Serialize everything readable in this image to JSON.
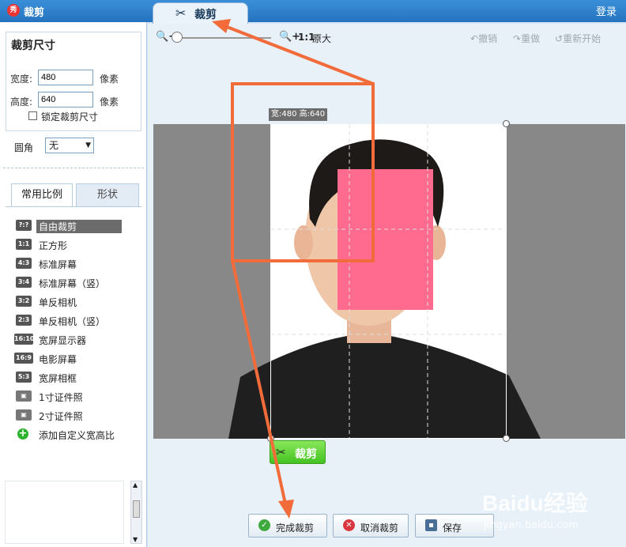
{
  "titlebar": {
    "app_icon_text": "秀",
    "title": "裁剪",
    "login": "登录"
  },
  "tab": {
    "label": "裁剪",
    "icon": "scissors-icon"
  },
  "size_panel": {
    "title": "裁剪尺寸",
    "width_label": "宽度:",
    "width_value": "480",
    "height_label": "高度:",
    "height_value": "640",
    "unit": "像素",
    "lock_label": "锁定裁剪尺寸",
    "lock_checked": false,
    "corner_label": "圆角",
    "corner_value": "无"
  },
  "ratio_tabs": {
    "common": "常用比例",
    "shape": "形状"
  },
  "ratios": [
    {
      "icon": "?:?",
      "label": "自由裁剪",
      "selected": true
    },
    {
      "icon": "1:1",
      "label": "正方形"
    },
    {
      "icon": "4:3",
      "label": "标准屏幕"
    },
    {
      "icon": "3:4",
      "label": "标准屏幕（竖）"
    },
    {
      "icon": "3:2",
      "label": "单反相机"
    },
    {
      "icon": "2:3",
      "label": "单反相机（竖）"
    },
    {
      "icon": "16:10",
      "label": "宽屏显示器"
    },
    {
      "icon": "16:9",
      "label": "电影屏幕"
    },
    {
      "icon": "5:3",
      "label": "宽屏相框"
    },
    {
      "icon": "id-photo-icon",
      "label": "1寸证件照"
    },
    {
      "icon": "id-photo-icon",
      "label": "2寸证件照"
    },
    {
      "icon": "plus-icon",
      "label": "添加自定义宽高比"
    }
  ],
  "toolbar": {
    "zoom_ratio": "1:1",
    "original": "原大",
    "undo": "撤销",
    "redo": "重做",
    "restart": "重新开始"
  },
  "canvas": {
    "size_label": "宽:480 高:640"
  },
  "crop_button": "裁剪",
  "actions": {
    "finish": "完成裁剪",
    "cancel": "取消裁剪",
    "save": "保存"
  },
  "watermark": {
    "logo": "Baidu经验",
    "url": "jingyan.baidu.com"
  },
  "colors": {
    "accent_blue": "#2573bf",
    "crop_green": "#44c222",
    "annotation_orange": "#f26b3a",
    "face_mask_pink": "#ff6b8e"
  }
}
